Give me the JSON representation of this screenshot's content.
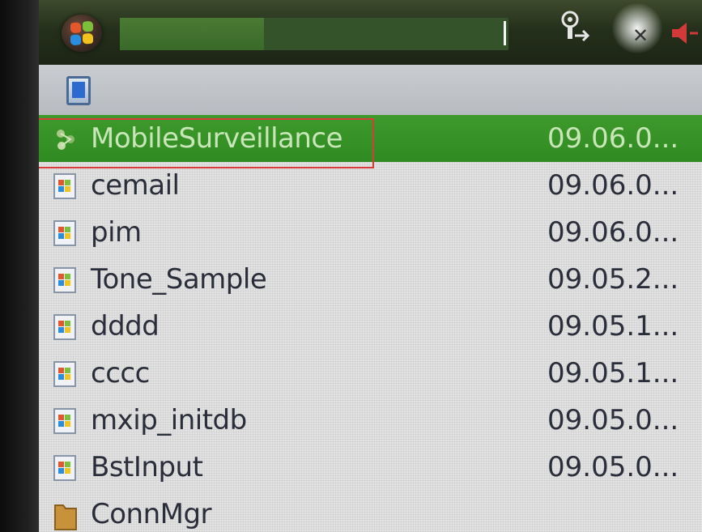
{
  "taskbar": {
    "start_icon": "windows-flag-icon",
    "title_value": "",
    "tray_icons": [
      "connectivity-icon",
      "signal-off-icon",
      "volume-icon"
    ]
  },
  "path_bar": {
    "icon": "device-icon"
  },
  "files": [
    {
      "name": "MobileSurveillance",
      "date": "09.06.0...",
      "icon": "app-icon",
      "selected": true
    },
    {
      "name": "cemail",
      "date": "09.06.0...",
      "icon": "exe-icon",
      "selected": false
    },
    {
      "name": "pim",
      "date": "09.06.0...",
      "icon": "exe-icon",
      "selected": false
    },
    {
      "name": "Tone_Sample",
      "date": "09.05.2...",
      "icon": "exe-icon",
      "selected": false
    },
    {
      "name": "dddd",
      "date": "09.05.1...",
      "icon": "exe-icon",
      "selected": false
    },
    {
      "name": "cccc",
      "date": "09.05.1...",
      "icon": "exe-icon",
      "selected": false
    },
    {
      "name": "mxip_initdb",
      "date": "09.05.0...",
      "icon": "exe-icon",
      "selected": false
    },
    {
      "name": "BstInput",
      "date": "09.05.0...",
      "icon": "exe-icon",
      "selected": false
    },
    {
      "name": "ConnMgr",
      "date": "",
      "icon": "folder-icon",
      "selected": false
    }
  ],
  "colors": {
    "taskbar": "#24301b",
    "selection": "#2f8a22",
    "highlight_box": "#d93a3a",
    "list_background": "#e3e3e3",
    "text": "#2a2e3a"
  }
}
